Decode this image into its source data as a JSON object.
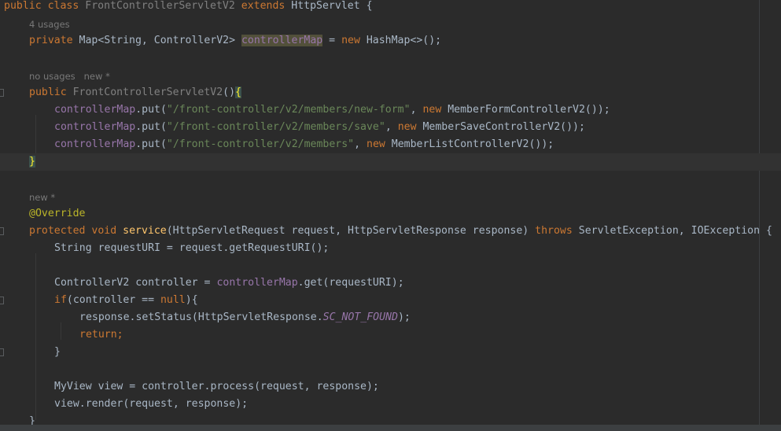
{
  "editor": {
    "lines": {
      "class_decl": {
        "public": "public",
        "class": "class",
        "name": "FrontControllerServletV2",
        "extends": "extends",
        "parent": "HttpServlet",
        "brace": "{"
      },
      "usages_hint": "4 usages",
      "field_decl": {
        "private": "private",
        "type": "Map<String, ControllerV2>",
        "name": "controllerMap",
        "assign": "=",
        "new": "new",
        "rest": "HashMap<>();"
      },
      "ctor_hint": "no usages   new *",
      "ctor_decl": {
        "public": "public",
        "name": "FrontControllerServletV2",
        "parens": "()",
        "brace": "{"
      },
      "put1": {
        "field": "controllerMap",
        "call": ".put(",
        "str": "\"/front-controller/v2/members/new-form\"",
        "comma": ", ",
        "new": "new",
        "rest": " MemberFormControllerV2());"
      },
      "put2": {
        "field": "controllerMap",
        "call": ".put(",
        "str": "\"/front-controller/v2/members/save\"",
        "comma": ", ",
        "new": "new",
        "rest": " MemberSaveControllerV2());"
      },
      "put3": {
        "field": "controllerMap",
        "call": ".put(",
        "str": "\"/front-controller/v2/members\"",
        "comma": ", ",
        "new": "new",
        "rest": " MemberListControllerV2());"
      },
      "ctor_close": "}",
      "service_hint": "new *",
      "override": "@Override",
      "service_decl": {
        "protected": "protected",
        "void": "void",
        "name": "service",
        "params": "(HttpServletRequest request, HttpServletResponse response)",
        "throws": "throws",
        "exceptions": "ServletException, IOException {"
      },
      "request_uri": {
        "text": "String requestURI = request.getRequestURI();"
      },
      "controller_get": {
        "prefix": "ControllerV2 controller = ",
        "field": "controllerMap",
        "rest": ".get(requestURI);"
      },
      "if_line": {
        "if": "if",
        "mid": "(controller == ",
        "null": "null",
        "rest": "){"
      },
      "set_status": {
        "prefix": "response.setStatus(HttpServletResponse.",
        "const": "SC_NOT_FOUND",
        "rest": ");"
      },
      "return_line": {
        "kw": "return",
        "rest": ";"
      },
      "if_close": "}",
      "process_line": {
        "text": "MyView view = controller.process(request, response);"
      },
      "render_line": {
        "text": "view.render(request, response);"
      },
      "method_close": "}"
    }
  },
  "colors": {
    "background": "#2b2b2b",
    "keyword": "#cc7832",
    "function": "#ffc66d",
    "field": "#9876aa",
    "string": "#6a8759",
    "annotation": "#bbb529",
    "default_text": "#a9b7c6"
  }
}
